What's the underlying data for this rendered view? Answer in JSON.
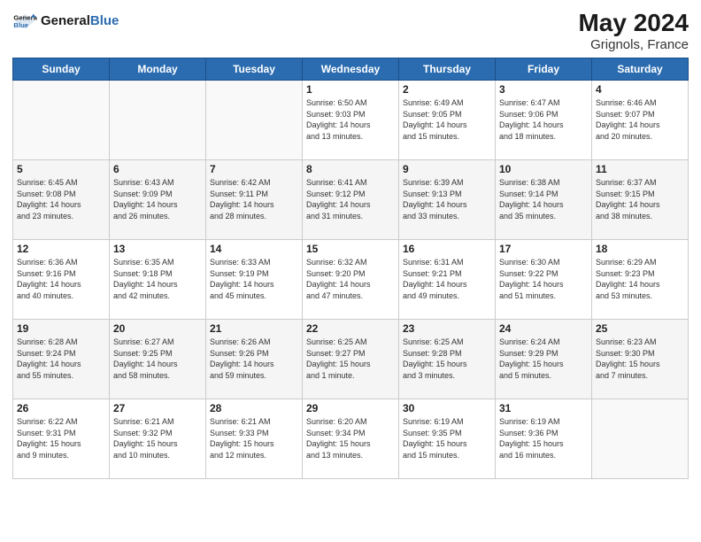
{
  "header": {
    "logo_general": "General",
    "logo_blue": "Blue",
    "title": "May 2024",
    "location": "Grignols, France"
  },
  "days_of_week": [
    "Sunday",
    "Monday",
    "Tuesday",
    "Wednesday",
    "Thursday",
    "Friday",
    "Saturday"
  ],
  "weeks": [
    [
      {
        "day": "",
        "info": ""
      },
      {
        "day": "",
        "info": ""
      },
      {
        "day": "",
        "info": ""
      },
      {
        "day": "1",
        "info": "Sunrise: 6:50 AM\nSunset: 9:03 PM\nDaylight: 14 hours\nand 13 minutes."
      },
      {
        "day": "2",
        "info": "Sunrise: 6:49 AM\nSunset: 9:05 PM\nDaylight: 14 hours\nand 15 minutes."
      },
      {
        "day": "3",
        "info": "Sunrise: 6:47 AM\nSunset: 9:06 PM\nDaylight: 14 hours\nand 18 minutes."
      },
      {
        "day": "4",
        "info": "Sunrise: 6:46 AM\nSunset: 9:07 PM\nDaylight: 14 hours\nand 20 minutes."
      }
    ],
    [
      {
        "day": "5",
        "info": "Sunrise: 6:45 AM\nSunset: 9:08 PM\nDaylight: 14 hours\nand 23 minutes."
      },
      {
        "day": "6",
        "info": "Sunrise: 6:43 AM\nSunset: 9:09 PM\nDaylight: 14 hours\nand 26 minutes."
      },
      {
        "day": "7",
        "info": "Sunrise: 6:42 AM\nSunset: 9:11 PM\nDaylight: 14 hours\nand 28 minutes."
      },
      {
        "day": "8",
        "info": "Sunrise: 6:41 AM\nSunset: 9:12 PM\nDaylight: 14 hours\nand 31 minutes."
      },
      {
        "day": "9",
        "info": "Sunrise: 6:39 AM\nSunset: 9:13 PM\nDaylight: 14 hours\nand 33 minutes."
      },
      {
        "day": "10",
        "info": "Sunrise: 6:38 AM\nSunset: 9:14 PM\nDaylight: 14 hours\nand 35 minutes."
      },
      {
        "day": "11",
        "info": "Sunrise: 6:37 AM\nSunset: 9:15 PM\nDaylight: 14 hours\nand 38 minutes."
      }
    ],
    [
      {
        "day": "12",
        "info": "Sunrise: 6:36 AM\nSunset: 9:16 PM\nDaylight: 14 hours\nand 40 minutes."
      },
      {
        "day": "13",
        "info": "Sunrise: 6:35 AM\nSunset: 9:18 PM\nDaylight: 14 hours\nand 42 minutes."
      },
      {
        "day": "14",
        "info": "Sunrise: 6:33 AM\nSunset: 9:19 PM\nDaylight: 14 hours\nand 45 minutes."
      },
      {
        "day": "15",
        "info": "Sunrise: 6:32 AM\nSunset: 9:20 PM\nDaylight: 14 hours\nand 47 minutes."
      },
      {
        "day": "16",
        "info": "Sunrise: 6:31 AM\nSunset: 9:21 PM\nDaylight: 14 hours\nand 49 minutes."
      },
      {
        "day": "17",
        "info": "Sunrise: 6:30 AM\nSunset: 9:22 PM\nDaylight: 14 hours\nand 51 minutes."
      },
      {
        "day": "18",
        "info": "Sunrise: 6:29 AM\nSunset: 9:23 PM\nDaylight: 14 hours\nand 53 minutes."
      }
    ],
    [
      {
        "day": "19",
        "info": "Sunrise: 6:28 AM\nSunset: 9:24 PM\nDaylight: 14 hours\nand 55 minutes."
      },
      {
        "day": "20",
        "info": "Sunrise: 6:27 AM\nSunset: 9:25 PM\nDaylight: 14 hours\nand 58 minutes."
      },
      {
        "day": "21",
        "info": "Sunrise: 6:26 AM\nSunset: 9:26 PM\nDaylight: 14 hours\nand 59 minutes."
      },
      {
        "day": "22",
        "info": "Sunrise: 6:25 AM\nSunset: 9:27 PM\nDaylight: 15 hours\nand 1 minute."
      },
      {
        "day": "23",
        "info": "Sunrise: 6:25 AM\nSunset: 9:28 PM\nDaylight: 15 hours\nand 3 minutes."
      },
      {
        "day": "24",
        "info": "Sunrise: 6:24 AM\nSunset: 9:29 PM\nDaylight: 15 hours\nand 5 minutes."
      },
      {
        "day": "25",
        "info": "Sunrise: 6:23 AM\nSunset: 9:30 PM\nDaylight: 15 hours\nand 7 minutes."
      }
    ],
    [
      {
        "day": "26",
        "info": "Sunrise: 6:22 AM\nSunset: 9:31 PM\nDaylight: 15 hours\nand 9 minutes."
      },
      {
        "day": "27",
        "info": "Sunrise: 6:21 AM\nSunset: 9:32 PM\nDaylight: 15 hours\nand 10 minutes."
      },
      {
        "day": "28",
        "info": "Sunrise: 6:21 AM\nSunset: 9:33 PM\nDaylight: 15 hours\nand 12 minutes."
      },
      {
        "day": "29",
        "info": "Sunrise: 6:20 AM\nSunset: 9:34 PM\nDaylight: 15 hours\nand 13 minutes."
      },
      {
        "day": "30",
        "info": "Sunrise: 6:19 AM\nSunset: 9:35 PM\nDaylight: 15 hours\nand 15 minutes."
      },
      {
        "day": "31",
        "info": "Sunrise: 6:19 AM\nSunset: 9:36 PM\nDaylight: 15 hours\nand 16 minutes."
      },
      {
        "day": "",
        "info": ""
      }
    ]
  ]
}
